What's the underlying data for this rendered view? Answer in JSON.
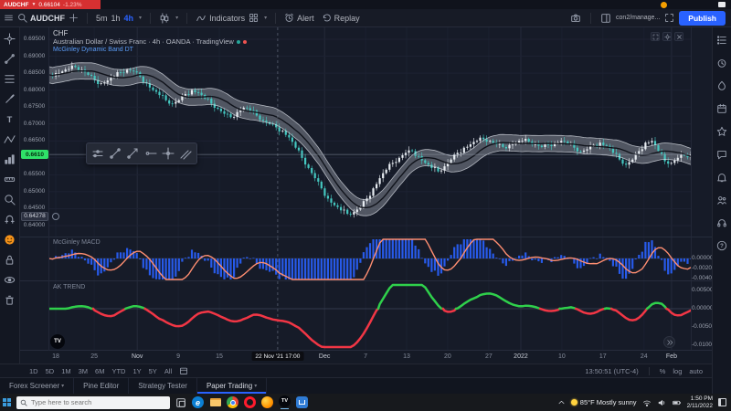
{
  "browser_tab": {
    "symbol": "AUDCHF",
    "price": "0.66104",
    "change": "-1.23%"
  },
  "toolbar": {
    "symbol": "AUDCHF",
    "timeframes": [
      "5m",
      "1h",
      "4h"
    ],
    "active_timeframe": "4h",
    "indicators_label": "Indicators",
    "alert_label": "Alert",
    "replay_label": "Replay",
    "account": "con2/manage...",
    "publish_label": "Publish"
  },
  "legend": {
    "line1": "CHF",
    "line2": "Australian Dollar / Swiss Franc · 4h · OANDA · TradingView",
    "indicator": "McGinley Dynamic Band DT"
  },
  "price_axis": {
    "labels": [
      "0.69500",
      "0.69000",
      "0.68500",
      "0.68000",
      "0.67500",
      "0.67000",
      "0.66500",
      "0.66000",
      "0.65500",
      "0.65000",
      "0.64500",
      "0.64000"
    ],
    "current_label": "0.6610",
    "marker_label": "0.64278"
  },
  "panels": {
    "macd": {
      "label": "McGinley MACD",
      "axis": [
        "0.00000",
        "-0.00200",
        "-0.00400"
      ]
    },
    "trend": {
      "label": "AK TREND",
      "axis": [
        "0.00500",
        "0.00000",
        "-0.00500",
        "-0.01000"
      ]
    }
  },
  "time_axis": {
    "labels": [
      {
        "t": "18",
        "x": 0.01
      },
      {
        "t": "25",
        "x": 0.07
      },
      {
        "t": "Nov",
        "x": 0.137,
        "major": true
      },
      {
        "t": "9",
        "x": 0.201
      },
      {
        "t": "15",
        "x": 0.265
      },
      {
        "t": "Dec",
        "x": 0.429,
        "major": true
      },
      {
        "t": "7",
        "x": 0.493
      },
      {
        "t": "13",
        "x": 0.557
      },
      {
        "t": "20",
        "x": 0.621
      },
      {
        "t": "27",
        "x": 0.685
      },
      {
        "t": "2022",
        "x": 0.735,
        "major": true
      },
      {
        "t": "10",
        "x": 0.799
      },
      {
        "t": "17",
        "x": 0.863
      },
      {
        "t": "24",
        "x": 0.927
      },
      {
        "t": "Feb",
        "x": 0.97,
        "major": true
      }
    ],
    "tooltip": {
      "text": "22 Nov '21 17:00",
      "x": 0.356
    }
  },
  "range_bar": {
    "ranges": [
      "1D",
      "5D",
      "1M",
      "3M",
      "6M",
      "YTD",
      "1Y",
      "5Y",
      "All"
    ],
    "clock": "13:50:51 (UTC-4)",
    "scales": [
      "%",
      "log",
      "auto"
    ]
  },
  "tabs": [
    {
      "label": "Forex Screener",
      "caret": true,
      "active": false
    },
    {
      "label": "Pine Editor",
      "caret": false,
      "active": false
    },
    {
      "label": "Strategy Tester",
      "caret": false,
      "active": false
    },
    {
      "label": "Paper Trading",
      "caret": true,
      "active": true
    }
  ],
  "taskbar": {
    "search_placeholder": "Type here to search",
    "weather": "85°F Mostly sunny",
    "time": "1:50 PM",
    "date": "2/11/2022"
  },
  "colors": {
    "accent": "#2962ff",
    "candle_up": "#e8edf2",
    "candle_down": "#45c7c0",
    "band": "rgba(192,197,206,0.35)",
    "band_center": "#0d1017",
    "macd_bar": "#2962ff",
    "macd_line": "#ff8e71",
    "trend_up": "#2fd04b",
    "trend_down": "#f23645",
    "price_tag": "#2fe068",
    "sell_red": "#f23645"
  },
  "chart_data": {
    "type": "candlestick",
    "symbol": "AUDCHF",
    "timeframe": "4h",
    "price": {
      "ylim": [
        0.6365,
        0.6985
      ],
      "current": 0.661,
      "marker": 0.64278,
      "closes": [
        0.6845,
        0.685,
        0.6855,
        0.6862,
        0.6868,
        0.686,
        0.6845,
        0.683,
        0.682,
        0.6828,
        0.684,
        0.6852,
        0.686,
        0.6855,
        0.684,
        0.682,
        0.68,
        0.6785,
        0.677,
        0.676,
        0.677,
        0.6788,
        0.68,
        0.6792,
        0.6775,
        0.676,
        0.6745,
        0.673,
        0.672,
        0.6735,
        0.6748,
        0.674,
        0.6725,
        0.671,
        0.67,
        0.669,
        0.668,
        0.666,
        0.663,
        0.66,
        0.657,
        0.654,
        0.651,
        0.648,
        0.646,
        0.6445,
        0.6435,
        0.644,
        0.6455,
        0.648,
        0.651,
        0.654,
        0.6565,
        0.6585,
        0.66,
        0.6615,
        0.662,
        0.6605,
        0.6585,
        0.657,
        0.656,
        0.6575,
        0.6595,
        0.6615,
        0.663,
        0.664,
        0.665,
        0.6655,
        0.665,
        0.664,
        0.6632,
        0.6638,
        0.6645,
        0.665,
        0.6648,
        0.664,
        0.6632,
        0.6638,
        0.6645,
        0.665,
        0.6642,
        0.663,
        0.6618,
        0.6625,
        0.6638,
        0.6645,
        0.6635,
        0.6615,
        0.6595,
        0.658,
        0.6595,
        0.662,
        0.6645,
        0.665,
        0.662,
        0.659,
        0.6585,
        0.66,
        0.6608,
        0.661
      ]
    },
    "macd": {
      "ylim": [
        -0.00455,
        0.00418
      ]
    },
    "trend": {
      "ylim": [
        -0.0115,
        0.0075
      ]
    }
  }
}
